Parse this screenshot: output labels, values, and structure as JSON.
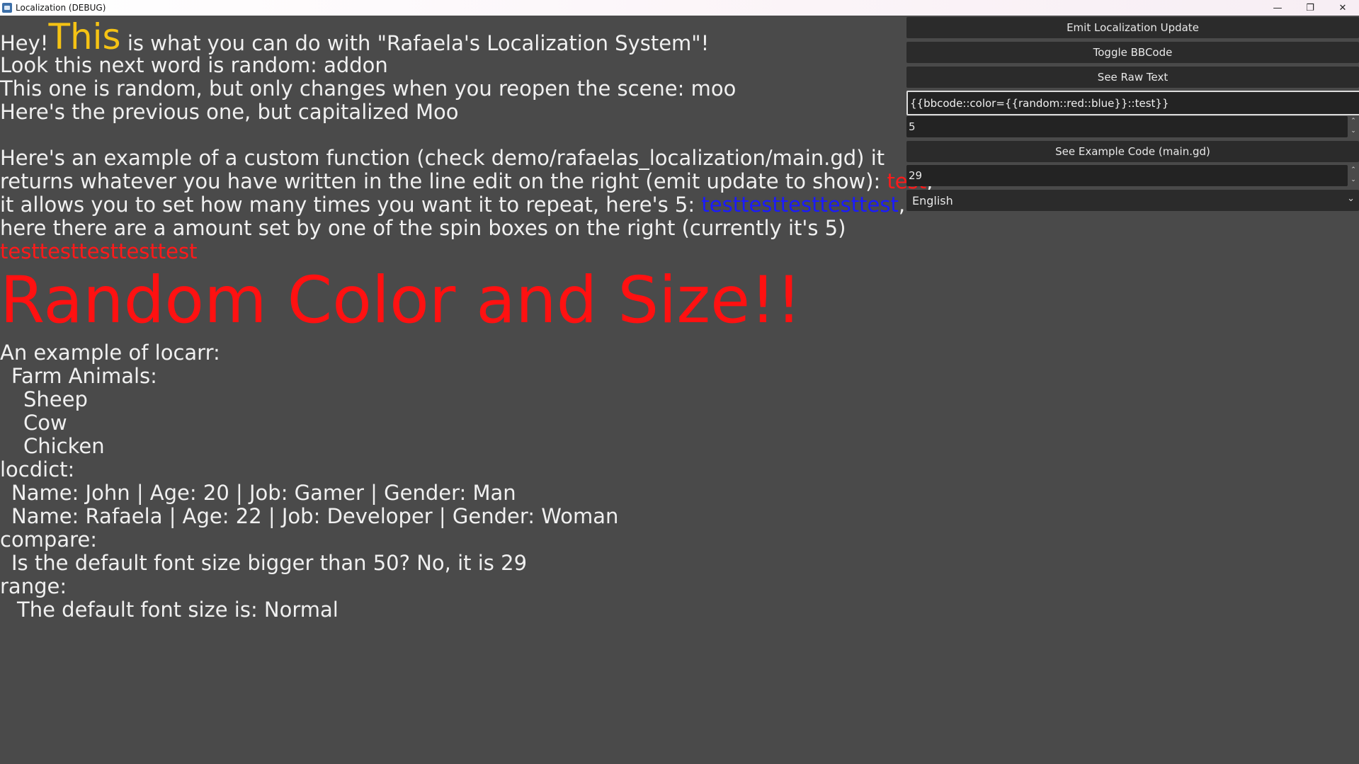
{
  "window": {
    "title": "Localization (DEBUG)",
    "minimize": "—",
    "restore": "❐",
    "close": "✕"
  },
  "content": {
    "line1_hey": "Hey!",
    "line1_this": "This",
    "line1_rest": " is what you can do with \"Rafaela's Localization System\"!",
    "line2": "Look this next word is random: addon",
    "line3": "This one is random, but only changes when you reopen the scene: moo",
    "line4": "Here's the previous one, but capitalized Moo",
    "custom_line1": "Here's an example of a custom function (check demo/rafaelas_localization/main.gd) it",
    "custom_line2_pre": "returns whatever you have written in the line edit on the right (emit update to show): ",
    "custom_line2_red": "test",
    "custom_line2_post": ",",
    "custom_line3_pre": "it allows you to set how many times you want it to repeat, here's 5: ",
    "custom_line3_blue": "testtesttesttesttest",
    "custom_line3_post": ",",
    "custom_line4": "here there are a amount set by one of the spin boxes on the right (currently it's 5)",
    "custom_line5_red": "testtesttesttesttest",
    "big_text": "Random Color and Size!!",
    "locarr_title": "An example of locarr:",
    "locarr_group": "Farm Animals:",
    "locarr_items": [
      "Sheep",
      "Cow",
      "Chicken"
    ],
    "locdict_title": "locdict:",
    "locdict_rows": [
      "Name: John | Age: 20 | Job: Gamer | Gender: Man",
      "Name: Rafaela | Age: 22 | Job: Developer | Gender: Woman"
    ],
    "compare_title": "compare:",
    "compare_line": "Is the default font size bigger than 50? No, it is 29",
    "range_title": "range:",
    "range_line": "The default font size is: Normal"
  },
  "panel": {
    "emit_button": "Emit Localization Update",
    "toggle_button": "Toggle BBCode",
    "raw_button": "See Raw Text",
    "line_edit_value": "{{bbcode::color={{random::red::blue}}::test}}",
    "repeat_spin_value": "5",
    "example_button": "See Example Code (main.gd)",
    "font_spin_value": "29",
    "language_value": "English"
  },
  "colors": {
    "background": "#4a4a4a",
    "highlight_yellow": "#f5c314",
    "red": "#ff1a1a",
    "blue": "#1a1aff"
  }
}
